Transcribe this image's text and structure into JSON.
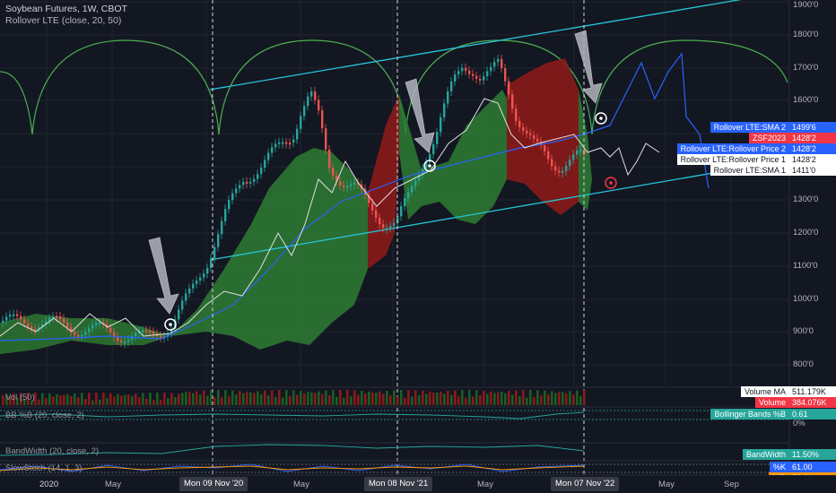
{
  "header": {
    "title": "Soybean Futures, 1W, CBOT",
    "indicator": "Rollover LTE (close, 20, 50)"
  },
  "y_axis": {
    "ticks": [
      "1900'0",
      "1800'0",
      "1700'0",
      "1600'0",
      "1500'0",
      "1400'0",
      "1300'0",
      "1200'0",
      "1100'0",
      "1000'0",
      "900'0",
      "800'0"
    ]
  },
  "x_axis": {
    "ticks": [
      "2020",
      "May",
      "Sep",
      "May",
      "Sep",
      "May",
      "Sep",
      "May",
      "Sep"
    ],
    "crosshair_dates": [
      "Mon 09 Nov '20",
      "Mon 08 Nov '21",
      "Mon 07 Nov '22"
    ]
  },
  "legend_tags": [
    {
      "name": "Rollover LTE:SMA 2",
      "value": "1499'6",
      "bg": "#2962ff",
      "fg": "#ffffff"
    },
    {
      "name": "ZSF2023",
      "value": "1428'2",
      "bg": "#f23645",
      "fg": "#ffffff"
    },
    {
      "name": "Rollover LTE:Rollover Price 2",
      "value": "1428'2",
      "bg": "#2962ff",
      "fg": "#ffffff"
    },
    {
      "name": "Rollover LTE:Rollover Price 1",
      "value": "1428'2",
      "bg": "#ffffff",
      "fg": "#131722"
    },
    {
      "name": "Rollover LTE:SMA 1",
      "value": "1411'0",
      "bg": "#ffffff",
      "fg": "#131722"
    }
  ],
  "panes": {
    "volume": {
      "label": "Vol (50)",
      "tags": [
        {
          "name": "Volume MA",
          "value": "511.179K",
          "bg": "#ffffff",
          "fg": "#131722"
        },
        {
          "name": "Volume",
          "value": "384.076K",
          "bg": "#f23645",
          "fg": "#ffffff"
        }
      ]
    },
    "bb": {
      "label": "BB %B (20, close, 2)",
      "tag": {
        "name": "Bollinger Bands %B",
        "value": "0.61",
        "bg": "#26a69a",
        "fg": "#ffffff"
      }
    },
    "bandwidth": {
      "label": "BandWidth (20, close, 2)",
      "tag": {
        "name": "BandWidth",
        "value": "11.50%",
        "bg": "#26a69a",
        "fg": "#ffffff"
      }
    },
    "stoch": {
      "label": "SlowStoch (14, 1, 3)",
      "tags": [
        {
          "name": "%K",
          "value": "61.00",
          "bg": "#2962ff",
          "fg": "#ffffff"
        },
        {
          "name": "%D",
          "value": "58.21",
          "bg": "#ff9800",
          "fg": "#ffffff"
        }
      ]
    }
  },
  "bb_scale": "0%",
  "colors": {
    "up": "#26a69a",
    "down": "#ef5350",
    "channel": "#26c6da",
    "cycle": "#4caf50",
    "sma": "#2962ff",
    "rollover": "#ffffff",
    "fill_green": "#2e7d32",
    "fill_red": "#8b1a1a",
    "background": "#131722"
  }
}
